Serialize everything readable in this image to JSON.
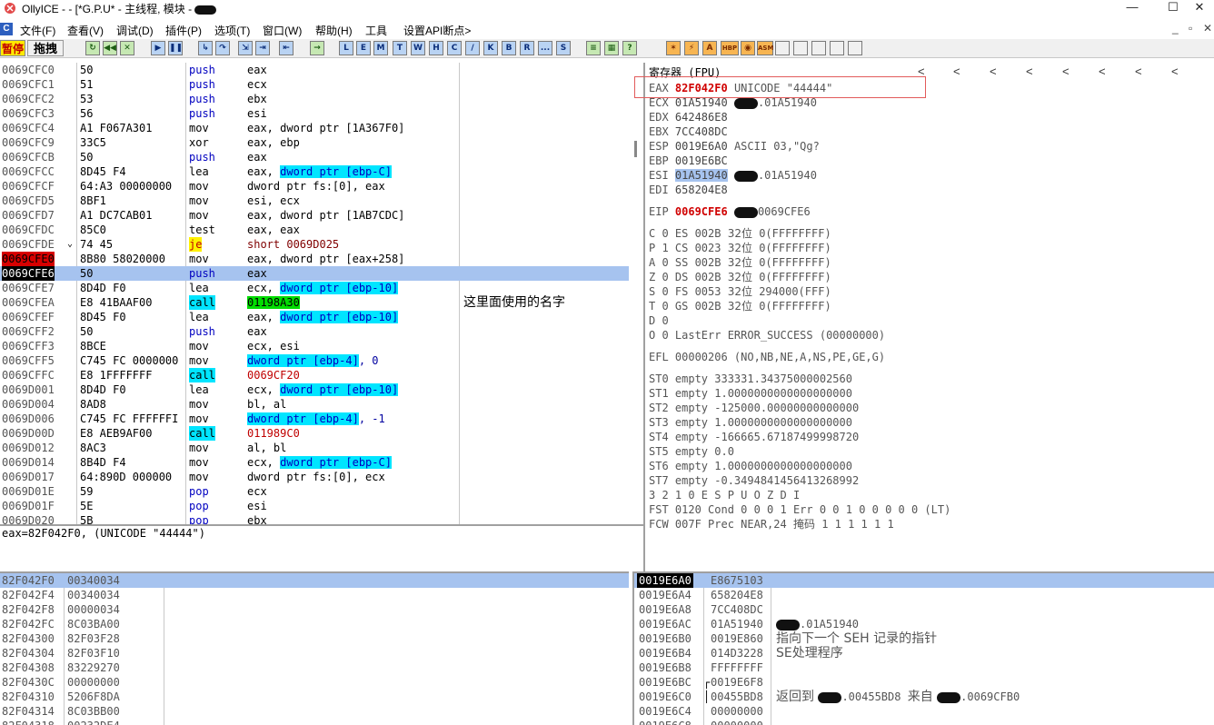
{
  "window": {
    "title": "OllyICE - - [*G.P.U* - 主线程, 模块 -",
    "controls": {
      "minimize": "—",
      "maximize": "☐",
      "close": "✕"
    }
  },
  "menu": {
    "items": [
      "文件(F)",
      "查看(V)",
      "调试(D)",
      "插件(P)",
      "选项(T)",
      "窗口(W)",
      "帮助(H)",
      "工具",
      "设置API断点>"
    ],
    "mdi_controls": [
      "_",
      "▫",
      "✕"
    ]
  },
  "toolbar": {
    "status_label": "暂停",
    "anim_label": "拖拽",
    "letter_buttons": [
      "L",
      "E",
      "M",
      "T",
      "W",
      "H",
      "C",
      "/",
      "K",
      "B",
      "R",
      "...",
      "S"
    ],
    "right_buttons": [
      "HBP",
      "ASM"
    ]
  },
  "disasm": {
    "rows": [
      {
        "addr": "0069CFC0",
        "hex": "50",
        "op": "push",
        "args": "eax"
      },
      {
        "addr": "0069CFC1",
        "hex": "51",
        "op": "push",
        "args": "ecx"
      },
      {
        "addr": "0069CFC2",
        "hex": "53",
        "op": "push",
        "args": "ebx"
      },
      {
        "addr": "0069CFC3",
        "hex": "56",
        "op": "push",
        "args": "esi"
      },
      {
        "addr": "0069CFC4",
        "hex": "A1 F067A301",
        "op": "mov",
        "args": "eax, dword ptr [1A367F0]"
      },
      {
        "addr": "0069CFC9",
        "hex": "33C5",
        "op": "xor",
        "args": "eax, ebp"
      },
      {
        "addr": "0069CFCB",
        "hex": "50",
        "op": "push",
        "args": "eax"
      },
      {
        "addr": "0069CFCC",
        "hex": "8D45 F4",
        "op": "lea",
        "args_pre": "eax, ",
        "args_mem": "dword ptr [ebp-C]"
      },
      {
        "addr": "0069CFCF",
        "hex": "64:A3 00000000",
        "op": "mov",
        "args": "dword ptr fs:[0], eax"
      },
      {
        "addr": "0069CFD5",
        "hex": "8BF1",
        "op": "mov",
        "args": "esi, ecx"
      },
      {
        "addr": "0069CFD7",
        "hex": "A1 DC7CAB01",
        "op": "mov",
        "args": "eax, dword ptr [1AB7CDC]"
      },
      {
        "addr": "0069CFDC",
        "hex": "85C0",
        "op": "test",
        "args": "eax, eax"
      },
      {
        "addr": "0069CFDE",
        "hex": "74 45",
        "op": "je",
        "args": "short 0069D025",
        "jump": "⌄"
      },
      {
        "addr": "0069CFE0",
        "hex": "8B80 58020000",
        "op": "mov",
        "args": "eax, dword ptr [eax+258]"
      },
      {
        "addr": "0069CFE6",
        "hex": "50",
        "op": "push",
        "args": "eax"
      },
      {
        "addr": "0069CFE7",
        "hex": "8D4D F0",
        "op": "lea",
        "args_pre": "ecx, ",
        "args_mem": "dword ptr [ebp-10]"
      },
      {
        "addr": "0069CFEA",
        "hex": "E8 41BAAF00",
        "op": "call",
        "args_green": "01198A30",
        "comment": "这里面使用的名字"
      },
      {
        "addr": "0069CFEF",
        "hex": "8D45 F0",
        "op": "lea",
        "args_pre": "eax, ",
        "args_mem": "dword ptr [ebp-10]"
      },
      {
        "addr": "0069CFF2",
        "hex": "50",
        "op": "push",
        "args": "eax"
      },
      {
        "addr": "0069CFF3",
        "hex": "8BCE",
        "op": "mov",
        "args": "ecx, esi"
      },
      {
        "addr": "0069CFF5",
        "hex": "C745 FC 0000000",
        "op": "mov",
        "args_mem": "dword ptr [ebp-4]",
        "args_post": ", 0"
      },
      {
        "addr": "0069CFFC",
        "hex": "E8 1FFFFFFF",
        "op": "call",
        "args_red": "0069CF20"
      },
      {
        "addr": "0069D001",
        "hex": "8D4D F0",
        "op": "lea",
        "args_pre": "ecx, ",
        "args_mem": "dword ptr [ebp-10]"
      },
      {
        "addr": "0069D004",
        "hex": "8AD8",
        "op": "mov",
        "args": "bl, al"
      },
      {
        "addr": "0069D006",
        "hex": "C745 FC FFFFFFI",
        "op": "mov",
        "args_mem": "dword ptr [ebp-4]",
        "args_post": ", -1"
      },
      {
        "addr": "0069D00D",
        "hex": "E8 AEB9AF00",
        "op": "call",
        "args_red": "011989C0"
      },
      {
        "addr": "0069D012",
        "hex": "8AC3",
        "op": "mov",
        "args": "al, bl"
      },
      {
        "addr": "0069D014",
        "hex": "8B4D F4",
        "op": "mov",
        "args_pre": "ecx, ",
        "args_mem": "dword ptr [ebp-C]"
      },
      {
        "addr": "0069D017",
        "hex": "64:890D 000000",
        "op": "mov",
        "args": "dword ptr fs:[0], ecx"
      },
      {
        "addr": "0069D01E",
        "hex": "59",
        "op": "pop",
        "args": "ecx"
      },
      {
        "addr": "0069D01F",
        "hex": "5E",
        "op": "pop",
        "args": "esi"
      },
      {
        "addr": "0069D020",
        "hex": "5B",
        "op": "pop",
        "args": "ebx"
      }
    ]
  },
  "info": {
    "text": "eax=82F042F0, (UNICODE \"44444\")"
  },
  "registers": {
    "title": "寄存器 (FPU)",
    "arrows": [
      "<",
      "<",
      "<",
      "<",
      "<",
      "<",
      "<",
      "<"
    ],
    "gp": [
      {
        "name": "EAX",
        "val": "82F042F0",
        "rest": "UNICODE \"44444\""
      },
      {
        "name": "ECX",
        "val": "01A51940",
        "rest": ".01A51940"
      },
      {
        "name": "EDX",
        "val": "642486E8",
        "rest": ""
      },
      {
        "name": "EBX",
        "val": "7CC408DC",
        "rest": ""
      },
      {
        "name": "ESP",
        "val": "0019E6A0",
        "rest": "ASCII 03,\"Qg?"
      },
      {
        "name": "EBP",
        "val": "0019E6BC",
        "rest": ""
      },
      {
        "name": "ESI",
        "val": "01A51940",
        "rest": ".01A51940"
      },
      {
        "name": "EDI",
        "val": "658204E8",
        "rest": ""
      }
    ],
    "eip": {
      "name": "EIP",
      "val": "0069CFE6",
      "rest": "0069CFE6"
    },
    "flags": [
      {
        "f": "C 0",
        "seg": "ES 002B",
        "bits": "32位",
        "lim": "0(FFFFFFFF)"
      },
      {
        "f": "P 1",
        "seg": "CS 0023",
        "bits": "32位",
        "lim": "0(FFFFFFFF)"
      },
      {
        "f": "A 0",
        "seg": "SS 002B",
        "bits": "32位",
        "lim": "0(FFFFFFFF)"
      },
      {
        "f": "Z 0",
        "seg": "DS 002B",
        "bits": "32位",
        "lim": "0(FFFFFFFF)"
      },
      {
        "f": "S 0",
        "seg": "FS 0053",
        "bits": "32位",
        "lim": "294000(FFF)"
      },
      {
        "f": "T 0",
        "seg": "GS 002B",
        "bits": "32位",
        "lim": "0(FFFFFFFF)"
      },
      {
        "f": "D 0",
        "seg": "",
        "bits": "",
        "lim": ""
      }
    ],
    "lasterr": "O 0  LastErr ERROR_SUCCESS (00000000)",
    "efl": "EFL 00000206 (NO,NB,NE,A,NS,PE,GE,G)",
    "st": [
      "ST0 empty 333331.34375000002560",
      "ST1 empty 1.0000000000000000000",
      "ST2 empty -125000.00000000000000",
      "ST3 empty 1.0000000000000000000",
      "ST4 empty -166665.67187499998720",
      "ST5 empty 0.0",
      "ST6 empty 1.0000000000000000000",
      "ST7 empty -0.3494841456413268992"
    ],
    "fpu_header": "              3 2 1 0      E S P U O Z D I",
    "fst": "FST 0120  Cond 0 0 0 1  Err 0 0 1 0 0 0 0 0  (LT)",
    "fcw_pre": "FCW 007F  Prec NEAR,24  ",
    "fcw_mask": "掩码",
    "fcw_post": "    1 1 1 1 1 1"
  },
  "dump": {
    "rows": [
      {
        "addr": "82F042F0",
        "val": "00340034"
      },
      {
        "addr": "82F042F4",
        "val": "00340034"
      },
      {
        "addr": "82F042F8",
        "val": "00000034"
      },
      {
        "addr": "82F042FC",
        "val": "8C03BA00"
      },
      {
        "addr": "82F04300",
        "val": "82F03F28"
      },
      {
        "addr": "82F04304",
        "val": "82F03F10"
      },
      {
        "addr": "82F04308",
        "val": "83229270"
      },
      {
        "addr": "82F0430C",
        "val": "00000000"
      },
      {
        "addr": "82F04310",
        "val": "5206F8DA"
      },
      {
        "addr": "82F04314",
        "val": "8C03BB00"
      },
      {
        "addr": "82F04318",
        "val": "00232DE4"
      }
    ]
  },
  "stack": {
    "rows": [
      {
        "addr": "0019E6A0",
        "val": "E8675103",
        "cmt": ""
      },
      {
        "addr": "0019E6A4",
        "val": "658204E8",
        "cmt": ""
      },
      {
        "addr": "0019E6A8",
        "val": "7CC408DC",
        "cmt": ""
      },
      {
        "addr": "0019E6AC",
        "val": "01A51940",
        "cmt": ".01A51940",
        "redact": true
      },
      {
        "addr": "0019E6B0",
        "val": "0019E860",
        "cmt": "指向下一个 SEH 记录的指针"
      },
      {
        "addr": "0019E6B4",
        "val": "014D3228",
        "cmt": "SE处理程序"
      },
      {
        "addr": "0019E6B8",
        "val": "FFFFFFFF",
        "cmt": ""
      },
      {
        "addr": "0019E6BC",
        "val": "0019E6F8",
        "cmt": ""
      },
      {
        "addr": "0019E6C0",
        "val": "00455BD8",
        "cmt_pre": "返回到 ",
        "cmt_mid": ".00455BD8 来自 ",
        "cmt_post": ".0069CFB0"
      },
      {
        "addr": "0019E6C4",
        "val": "00000000",
        "cmt": ""
      },
      {
        "addr": "0019E6C8",
        "val": "00000000",
        "cmt": ""
      }
    ]
  },
  "colors": {
    "selection": "#a6c3ef",
    "call_bg": "#00e5ff",
    "breakpoint_addr": "#d60000",
    "jump_bg": "#fff200",
    "call_target_green": "#00dd00",
    "eip_red": "#d00000"
  }
}
